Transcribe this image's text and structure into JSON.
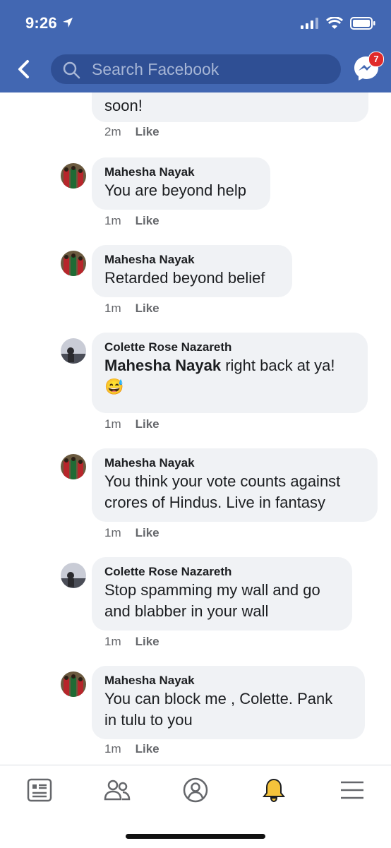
{
  "status_bar": {
    "time": "9:26"
  },
  "search": {
    "placeholder": "Search Facebook"
  },
  "messenger": {
    "badge_count": "7"
  },
  "colors": {
    "header": "#4267b2",
    "bubble": "#f0f2f5",
    "badge": "#e02a2a",
    "bell": "#f5c33b"
  },
  "comments": [
    {
      "name": "",
      "text": "soon!",
      "time": "2m",
      "like": "Like"
    },
    {
      "name": "Mahesha Nayak",
      "text": "You are beyond help",
      "time": "1m",
      "like": "Like"
    },
    {
      "name": "Mahesha Nayak",
      "text": "Retarded beyond belief",
      "time": "1m",
      "like": "Like"
    },
    {
      "name": "Colette Rose Nazareth",
      "mention": "Mahesha Nayak",
      "text": " right back at ya!",
      "emoji": "😅",
      "time": "1m",
      "like": "Like"
    },
    {
      "name": "Mahesha Nayak",
      "line1": "You think your vote counts against",
      "line2": "crores of Hindus. Live in fantasy",
      "time": "1m",
      "like": "Like"
    },
    {
      "name": "Colette Rose Nazareth",
      "line1": "Stop spamming my wall and go",
      "line2": "and blabber in your wall",
      "time": "1m",
      "like": "Like"
    },
    {
      "name": "Mahesha Nayak",
      "line1": "You can block me , Colette. Pank",
      "line2": "in tulu to you",
      "time": "1m",
      "like": "Like"
    }
  ],
  "tabs": [
    {
      "icon": "news-feed-icon"
    },
    {
      "icon": "friends-icon"
    },
    {
      "icon": "profile-icon"
    },
    {
      "icon": "notifications-bell-icon"
    },
    {
      "icon": "menu-icon"
    }
  ]
}
